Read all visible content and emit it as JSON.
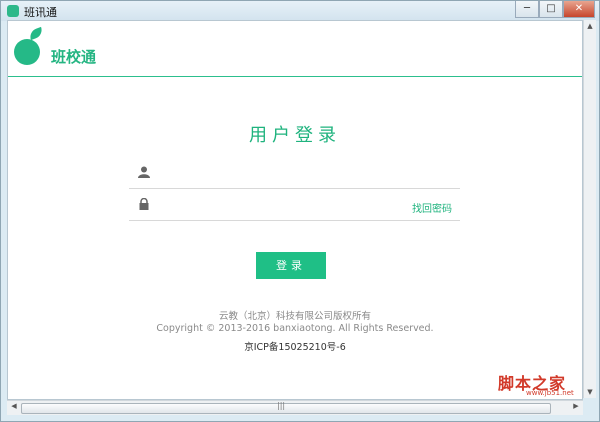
{
  "window": {
    "title": "班讯通",
    "controls": {
      "minimize": "─",
      "maximize": "□",
      "close": "✕"
    }
  },
  "header": {
    "logo_text": "班校通"
  },
  "login": {
    "title": "用户登录",
    "username_placeholder": "",
    "password_placeholder": "",
    "forgot_label": "找回密码",
    "submit_label": "登录"
  },
  "footer": {
    "company": "云教（北京）科技有限公司版权所有",
    "copyright": "Copyright © 2013-2016 banxiaotong. All Rights Reserved.",
    "icp": "京ICP备15025210号-6"
  },
  "watermark": {
    "text": "脚本之家",
    "sub": "www.jb51.net"
  },
  "scrollbar": {
    "up": "▲",
    "down": "▼",
    "left": "◀",
    "right": "▶",
    "grip": "|||"
  },
  "colors": {
    "accent": "#1fb37e",
    "button": "#1fbf86",
    "divider": "#2cbf8d"
  },
  "icons": {
    "user": "user-icon",
    "lock": "lock-icon"
  }
}
